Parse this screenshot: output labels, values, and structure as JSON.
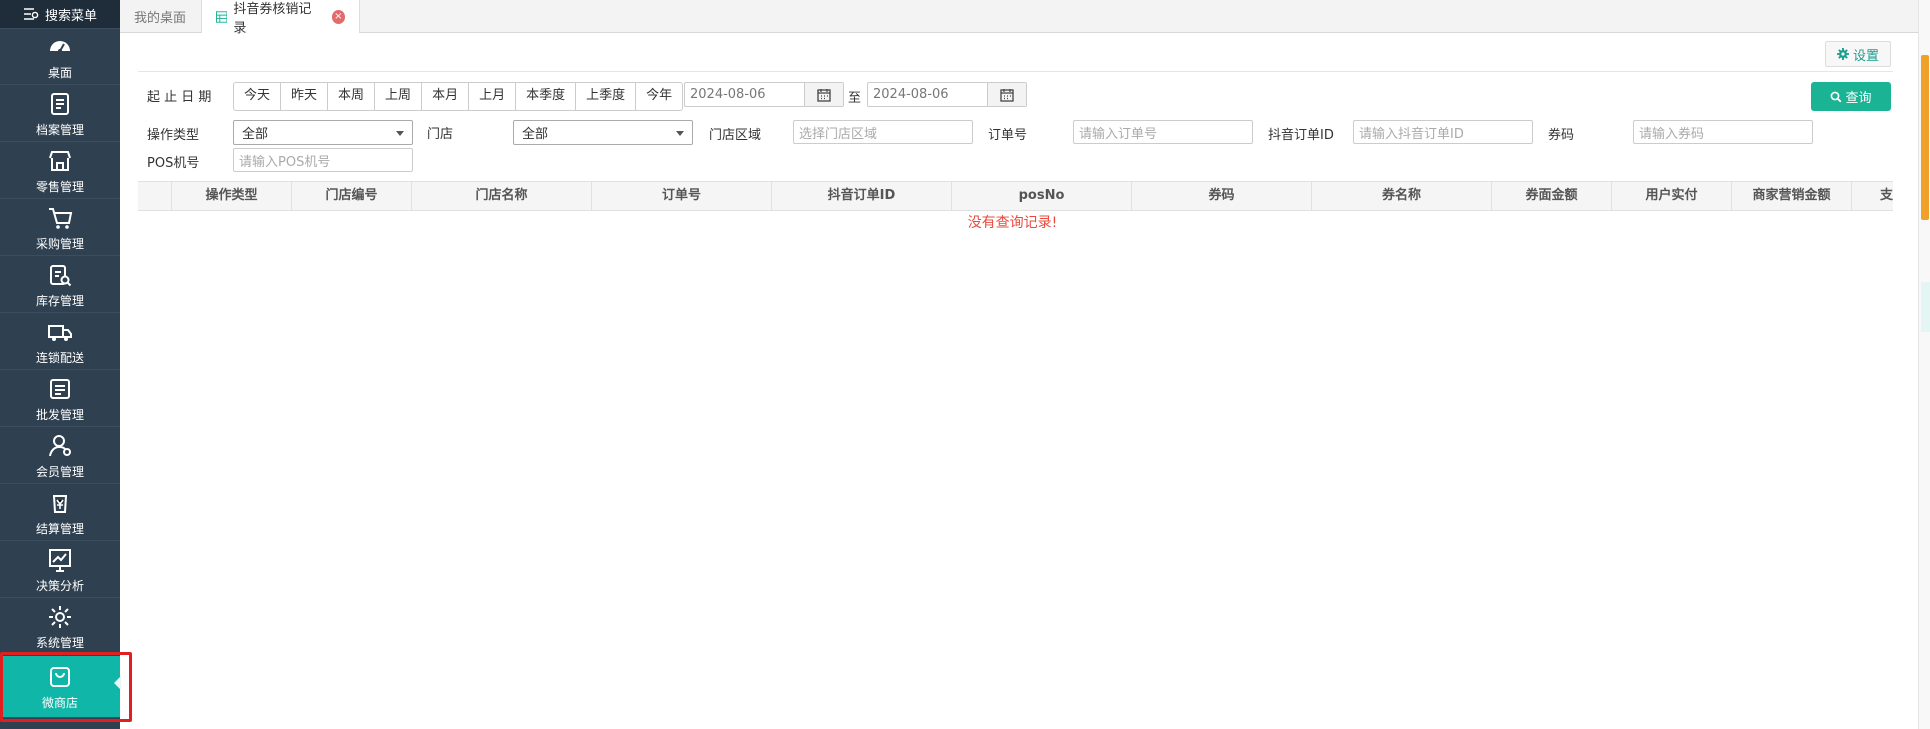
{
  "sidebar": {
    "search_label": "搜索菜单",
    "items": [
      {
        "label": "桌面",
        "icon": "dashboard-icon"
      },
      {
        "label": "档案管理",
        "icon": "archive-icon"
      },
      {
        "label": "零售管理",
        "icon": "store-icon"
      },
      {
        "label": "采购管理",
        "icon": "cart-icon"
      },
      {
        "label": "库存管理",
        "icon": "inventory-icon"
      },
      {
        "label": "连锁配送",
        "icon": "truck-icon"
      },
      {
        "label": "批发管理",
        "icon": "wholesale-icon"
      },
      {
        "label": "会员管理",
        "icon": "member-icon"
      },
      {
        "label": "结算管理",
        "icon": "yuan-icon"
      },
      {
        "label": "决策分析",
        "icon": "chart-icon"
      },
      {
        "label": "系统管理",
        "icon": "gear-icon"
      },
      {
        "label": "微商店",
        "icon": "shopping-bag-icon",
        "active": true
      }
    ]
  },
  "tabs": {
    "home": "我的桌面",
    "active": "抖音券核销记录"
  },
  "toolbar": {
    "settings_label": "设置",
    "query_label": "查询"
  },
  "filters": {
    "date_label": "起 止 日 期",
    "quick_dates": [
      "今天",
      "昨天",
      "本周",
      "上周",
      "本月",
      "上月",
      "本季度",
      "上季度",
      "今年"
    ],
    "start_date": "2024-08-06",
    "to_label": "至",
    "end_date": "2024-08-06",
    "op_type_label": "操作类型",
    "op_type_value": "全部",
    "store_label": "门店",
    "store_value": "全部",
    "region_label": "门店区域",
    "region_placeholder": "选择门店区域",
    "order_label": "订单号",
    "order_placeholder": "请输入订单号",
    "douyin_order_label": "抖音订单ID",
    "douyin_order_placeholder": "请输入抖音订单ID",
    "coupon_label": "券码",
    "coupon_placeholder": "请输入券码",
    "pos_label": "POS机号",
    "pos_placeholder": "请输入POS机号"
  },
  "table": {
    "columns": [
      "操作类型",
      "门店编号",
      "门店名称",
      "订单号",
      "抖音订单ID",
      "posNo",
      "券码",
      "券名称",
      "券面金额",
      "用户实付",
      "商家营销金额",
      "支付"
    ],
    "empty_message": "没有查询记录!"
  },
  "colors": {
    "sidebar_bg": "#2f4050",
    "active_item": "#10b7a8",
    "primary": "#1ab394",
    "empty_text": "#e54c3c"
  }
}
